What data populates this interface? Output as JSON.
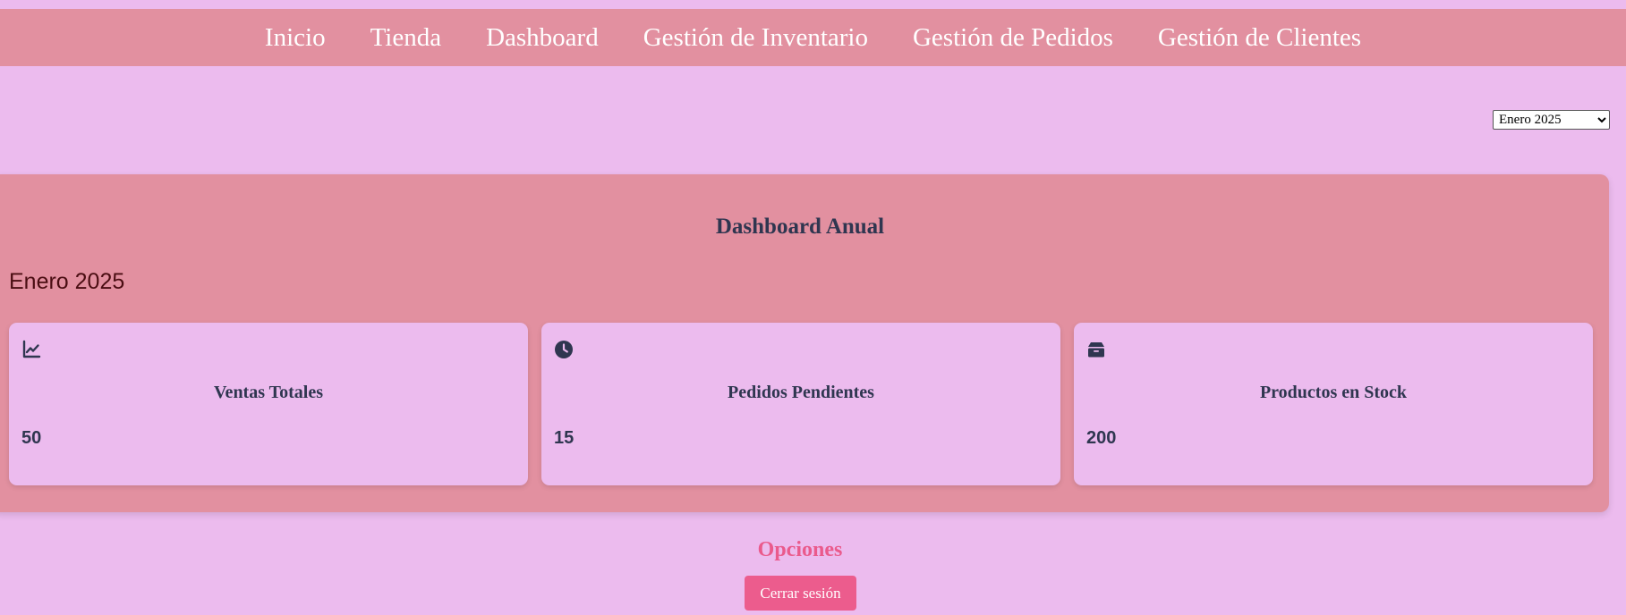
{
  "nav": {
    "items": [
      {
        "label": "Inicio"
      },
      {
        "label": "Tienda"
      },
      {
        "label": "Dashboard"
      },
      {
        "label": "Gestión de Inventario"
      },
      {
        "label": "Gestión de Pedidos"
      },
      {
        "label": "Gestión de Clientes"
      }
    ]
  },
  "filter": {
    "selected_month": "Enero 2025"
  },
  "dashboard": {
    "title": "Dashboard Anual",
    "period": "Enero 2025",
    "cards": [
      {
        "icon": "chart-line-icon",
        "title": "Ventas Totales",
        "value": "50"
      },
      {
        "icon": "clock-icon",
        "title": "Pedidos Pendientes",
        "value": "15"
      },
      {
        "icon": "box-icon",
        "title": "Productos en Stock",
        "value": "200"
      }
    ]
  },
  "options": {
    "title": "Opciones",
    "logout_label": "Cerrar sesión"
  },
  "colors": {
    "background": "#ecbbee",
    "navbar": "#e290a0",
    "panel": "#e290a0",
    "card": "#ecbbee",
    "text_dark": "#2f3650",
    "subtitle": "#4a0d12",
    "accent": "#ec5c8d"
  }
}
